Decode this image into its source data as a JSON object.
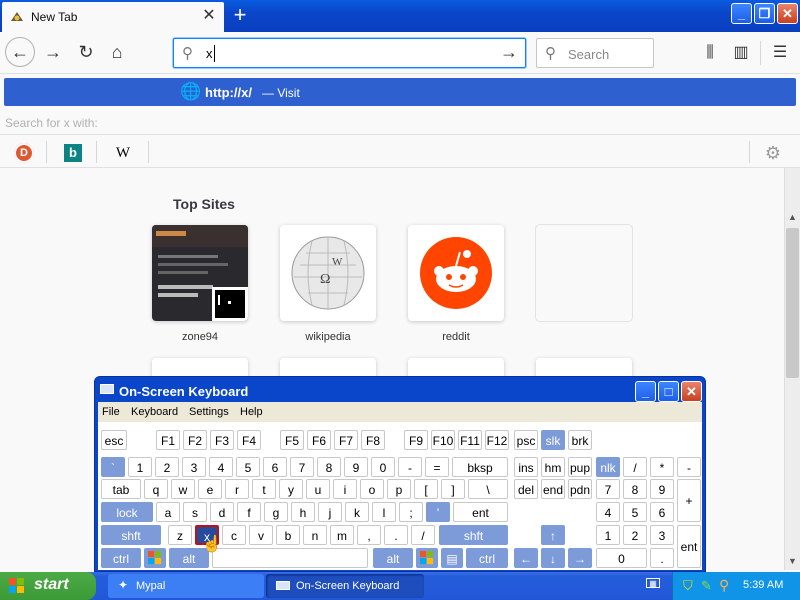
{
  "browser": {
    "tab": {
      "title": "New Tab"
    },
    "new_tab": "+",
    "window_controls": {
      "minimize": "_",
      "restore": "❐",
      "close": "✕"
    },
    "nav": {
      "back": "←",
      "forward": "→",
      "reload": "↻",
      "home": "⌂"
    },
    "urlbar": {
      "value": "x",
      "go": "→"
    },
    "search": {
      "placeholder": "Search"
    },
    "toolbar": {
      "library": "⫼",
      "sidebar": "▥",
      "menu": "☰"
    }
  },
  "autocomplete": {
    "suggestion_url": "http://x/",
    "suggestion_sep": "—",
    "suggestion_action": "Visit",
    "search_for": "Search for x with:",
    "engines": {
      "ddg": "D",
      "bing": "b",
      "wikipedia": "W"
    }
  },
  "topsites": {
    "title": "Top Sites",
    "sites": [
      {
        "label": "zone94"
      },
      {
        "label": "wikipedia"
      },
      {
        "label": "reddit"
      },
      {
        "label": ""
      }
    ]
  },
  "osk": {
    "title": "On-Screen Keyboard",
    "menu": [
      "File",
      "Keyboard",
      "Settings",
      "Help"
    ],
    "rows": {
      "r1": [
        "esc",
        "F1",
        "F2",
        "F3",
        "F4",
        "F5",
        "F6",
        "F7",
        "F8",
        "F9",
        "F10",
        "F11",
        "F12",
        "psc",
        "slk",
        "brk"
      ],
      "r2": [
        "`",
        "1",
        "2",
        "3",
        "4",
        "5",
        "6",
        "7",
        "8",
        "9",
        "0",
        "-",
        "=",
        "bksp",
        "ins",
        "hm",
        "pup",
        "nlk",
        "/",
        "*",
        "-"
      ],
      "r3": [
        "tab",
        "q",
        "w",
        "e",
        "r",
        "t",
        "y",
        "u",
        "i",
        "o",
        "p",
        "[",
        "]",
        "\\",
        "del",
        "end",
        "pdn",
        "7",
        "8",
        "9",
        "+"
      ],
      "r4": [
        "lock",
        "a",
        "s",
        "d",
        "f",
        "g",
        "h",
        "j",
        "k",
        "l",
        ";",
        "'",
        "ent",
        "4",
        "5",
        "6"
      ],
      "r5": [
        "shft",
        "z",
        "x",
        "c",
        "v",
        "b",
        "n",
        "m",
        ",",
        ".",
        "/",
        "shft",
        "↑",
        "1",
        "2",
        "3",
        "ent"
      ],
      "r6": [
        "ctrl",
        "alt",
        "alt",
        "ctrl",
        "←",
        "↓",
        "→",
        "0",
        "."
      ]
    }
  },
  "taskbar": {
    "start": "start",
    "tasks": [
      "Mypal",
      "On-Screen Keyboard"
    ],
    "clock": "5:39 AM"
  },
  "colors": {
    "xp_blue": "#0a46c9",
    "accent": "#0a84ff",
    "start_green": "#3c9b37",
    "reddit": "#ff4500"
  }
}
